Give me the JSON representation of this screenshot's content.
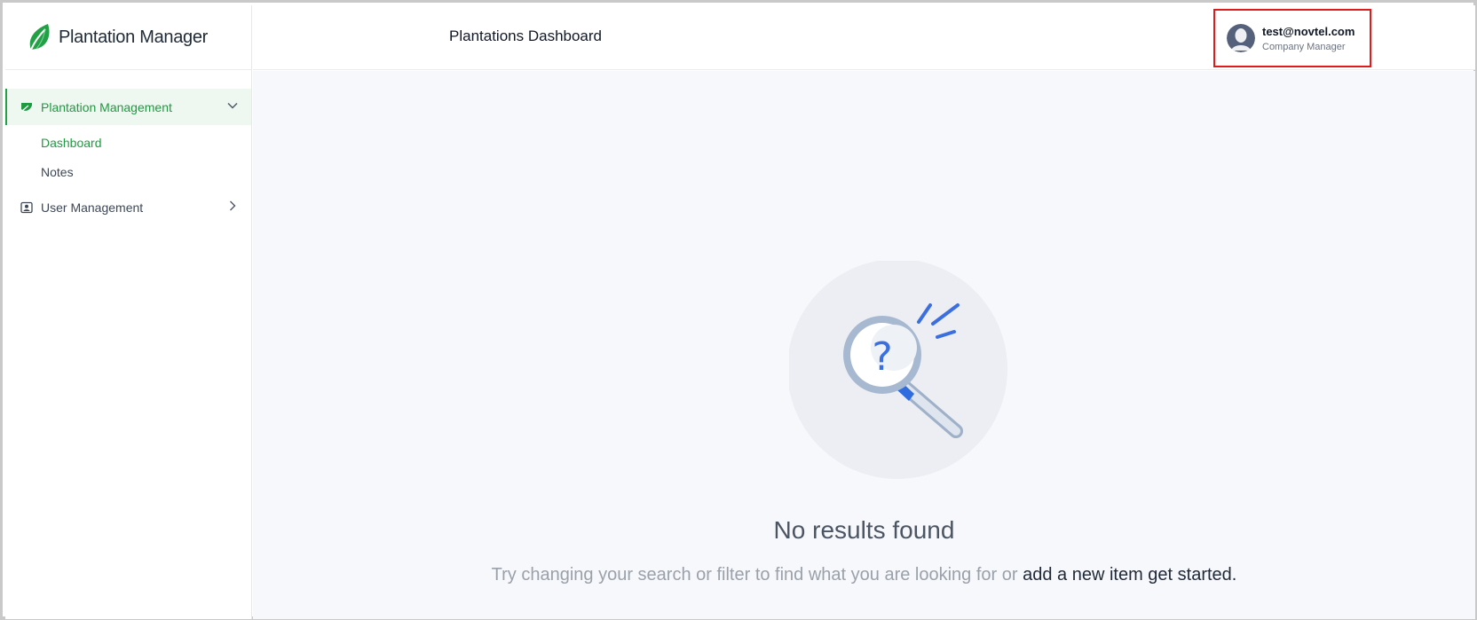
{
  "app": {
    "name": "Plantation Manager"
  },
  "header": {
    "title": "Plantations Dashboard",
    "user": {
      "email": "test@novtel.com",
      "role": "Company Manager"
    }
  },
  "sidebar": {
    "groups": [
      {
        "label": "Plantation Management",
        "icon": "leaf-icon",
        "expanded": true,
        "items": [
          {
            "label": "Dashboard",
            "active": true
          },
          {
            "label": "Notes",
            "active": false
          }
        ]
      },
      {
        "label": "User Management",
        "icon": "user-badge-icon",
        "expanded": false
      }
    ]
  },
  "empty_state": {
    "title": "No results found",
    "subtitle": "Try changing your search or filter to find what you are looking for or ",
    "link": "add a new item get started."
  },
  "colors": {
    "accent_green": "#1f9a40",
    "highlight_red": "#e01b1b",
    "illustration_blue": "#3b6fe0"
  }
}
